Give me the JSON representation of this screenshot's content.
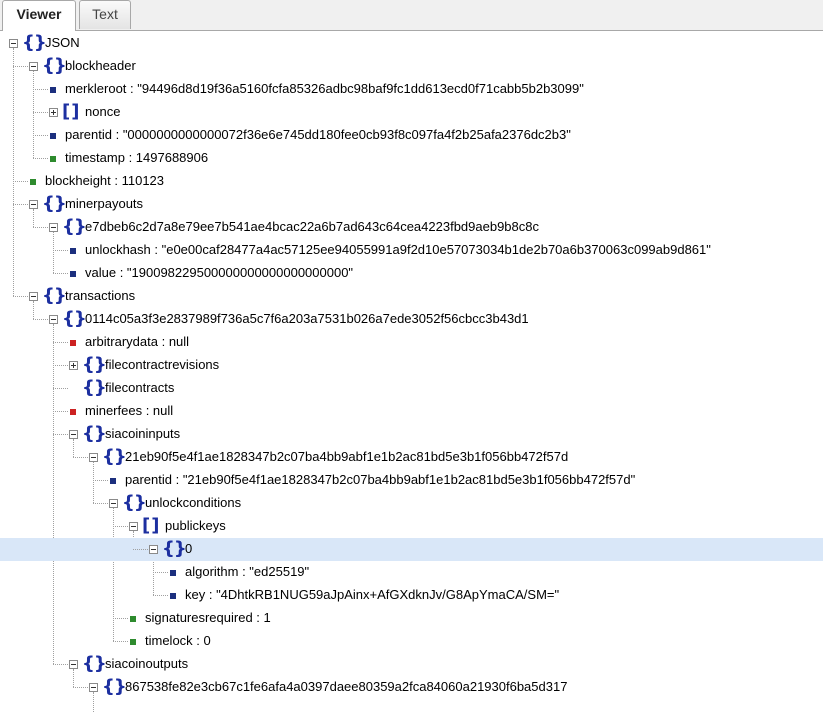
{
  "tabs": [
    {
      "label": "Viewer",
      "active": true
    },
    {
      "label": "Text",
      "active": false
    }
  ],
  "colors": {
    "object_icon": "#1c2fa0",
    "string_leaf": "#1c2f7e",
    "number_leaf": "#2e8b2e",
    "null_leaf": "#cc2222",
    "selected_row": "#d9e7f8"
  },
  "tree": [
    {
      "depth": 0,
      "kind": "object",
      "toggle": "minus",
      "label": "JSON"
    },
    {
      "depth": 1,
      "kind": "object",
      "toggle": "minus",
      "label": "blockheader"
    },
    {
      "depth": 2,
      "kind": "string",
      "label": "merkleroot : \"94496d8d19f36a5160fcfa85326adbc98baf9fc1dd613ecd0f71cabb5b2b3099\""
    },
    {
      "depth": 2,
      "kind": "array",
      "toggle": "plus",
      "label": "nonce"
    },
    {
      "depth": 2,
      "kind": "string",
      "label": "parentid : \"0000000000000072f36e6e745dd180fee0cb93f8c097fa4f2b25afa2376dc2b3\""
    },
    {
      "depth": 2,
      "kind": "number",
      "label": "timestamp : 1497688906"
    },
    {
      "depth": 1,
      "kind": "number",
      "label": "blockheight : 110123"
    },
    {
      "depth": 1,
      "kind": "object",
      "toggle": "minus",
      "label": "minerpayouts"
    },
    {
      "depth": 2,
      "kind": "object",
      "toggle": "minus",
      "label": "e7dbeb6c2d7a8e79ee7b541ae4bcac22a6b7ad643c64cea4223fbd9aeb9b8c8c"
    },
    {
      "depth": 3,
      "kind": "string",
      "label": "unlockhash : \"e0e00caf28477a4ac57125ee94055991a9f2d10e57073034b1de2b70a6b370063c099ab9d861\""
    },
    {
      "depth": 3,
      "kind": "string",
      "label": "value : \"190098229500000000000000000000\""
    },
    {
      "depth": 1,
      "kind": "object",
      "toggle": "minus",
      "label": "transactions"
    },
    {
      "depth": 2,
      "kind": "object",
      "toggle": "minus",
      "label": "0114c05a3f3e2837989f736a5c7f6a203a7531b026a7ede3052f56cbcc3b43d1"
    },
    {
      "depth": 3,
      "kind": "null",
      "label": "arbitrarydata : null"
    },
    {
      "depth": 3,
      "kind": "object",
      "toggle": "plus",
      "label": "filecontractrevisions"
    },
    {
      "depth": 3,
      "kind": "object",
      "toggle": "none",
      "label": "filecontracts"
    },
    {
      "depth": 3,
      "kind": "null",
      "label": "minerfees : null"
    },
    {
      "depth": 3,
      "kind": "object",
      "toggle": "minus",
      "label": "siacoininputs"
    },
    {
      "depth": 4,
      "kind": "object",
      "toggle": "minus",
      "label": "21eb90f5e4f1ae1828347b2c07ba4bb9abf1e1b2ac81bd5e3b1f056bb472f57d"
    },
    {
      "depth": 5,
      "kind": "string",
      "label": "parentid : \"21eb90f5e4f1ae1828347b2c07ba4bb9abf1e1b2ac81bd5e3b1f056bb472f57d\""
    },
    {
      "depth": 5,
      "kind": "object",
      "toggle": "minus",
      "label": "unlockconditions"
    },
    {
      "depth": 6,
      "kind": "array",
      "toggle": "minus",
      "label": "publickeys"
    },
    {
      "depth": 7,
      "kind": "object",
      "toggle": "minus",
      "label": "0",
      "selected": true
    },
    {
      "depth": 8,
      "kind": "string",
      "label": "algorithm : \"ed25519\""
    },
    {
      "depth": 8,
      "kind": "string",
      "label": "key : \"4DhtkRB1NUG59aJpAinx+AfGXdknJv/G8ApYmaCA/SM=\""
    },
    {
      "depth": 6,
      "kind": "number",
      "label": "signaturesrequired : 1"
    },
    {
      "depth": 6,
      "kind": "number",
      "label": "timelock : 0"
    },
    {
      "depth": 3,
      "kind": "object",
      "toggle": "minus",
      "label": "siacoinoutputs"
    },
    {
      "depth": 4,
      "kind": "object",
      "toggle": "minus",
      "label": "867538fe82e3cb67c1fe6afa4a0397daee80359a2fca84060a21930f6ba5d317"
    }
  ]
}
